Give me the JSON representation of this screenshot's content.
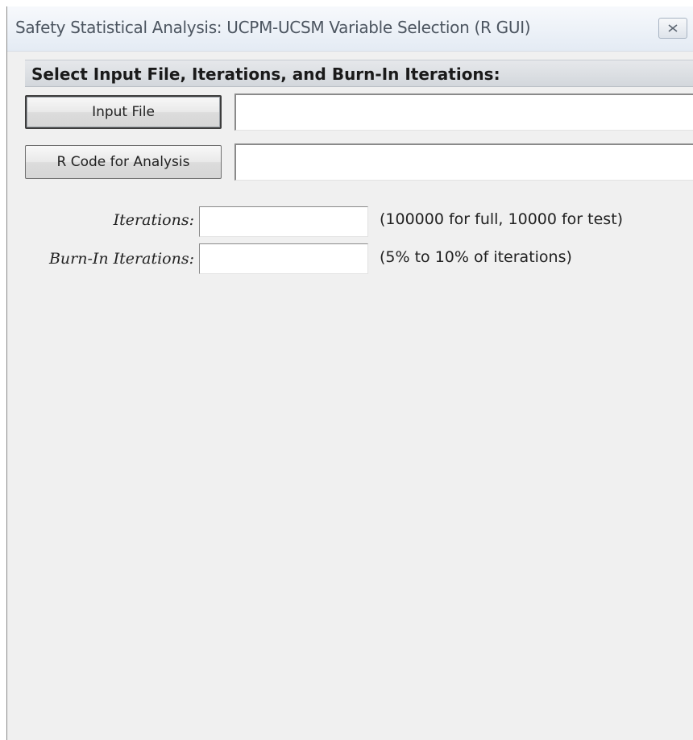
{
  "window": {
    "title": "Safety Statistical Analysis: UCPM-UCSM Variable Selection (R GUI)",
    "close_label": "✕"
  },
  "section": {
    "header": "Select Input File, Iterations, and Burn-In Iterations:"
  },
  "buttons": {
    "input_file": "Input File",
    "r_code": "R Code for Analysis"
  },
  "fields": {
    "input_file_path": "",
    "r_code_path": "",
    "iterations_value": "",
    "burnin_value": ""
  },
  "labels": {
    "iterations": "Iterations:",
    "burnin": "Burn-In Iterations:"
  },
  "hints": {
    "iterations": "(100000 for full, 10000 for test)",
    "burnin": "(5% to 10% of iterations)"
  }
}
